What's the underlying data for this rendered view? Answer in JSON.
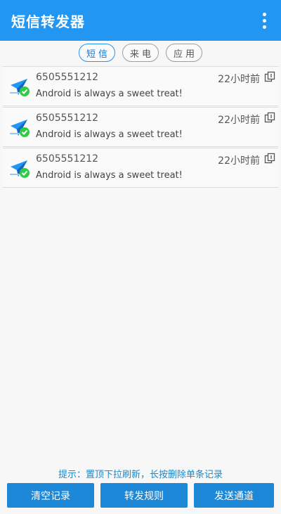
{
  "app_bar": {
    "title": "短信转发器",
    "menu_icon": "more-vert-icon"
  },
  "tabs": [
    {
      "label": "短信",
      "active": true
    },
    {
      "label": "来电",
      "active": false
    },
    {
      "label": "应用",
      "active": false
    }
  ],
  "messages": [
    {
      "phone": "6505551212",
      "time": "22小时前",
      "text": "Android is always a sweet treat!",
      "status": "sent-success"
    },
    {
      "phone": "6505551212",
      "time": "22小时前",
      "text": "Android is always a sweet treat!",
      "status": "sent-success"
    },
    {
      "phone": "6505551212",
      "time": "22小时前",
      "text": "Android is always a sweet treat!",
      "status": "sent-success"
    }
  ],
  "tip": "提示：置顶下拉刷新，长按删除单条记录",
  "buttons": {
    "clear": "清空记录",
    "rules": "转发规则",
    "channels": "发送通道"
  },
  "colors": {
    "primary": "#2196f3",
    "button": "#1e88d8",
    "success": "#2ecc40"
  }
}
